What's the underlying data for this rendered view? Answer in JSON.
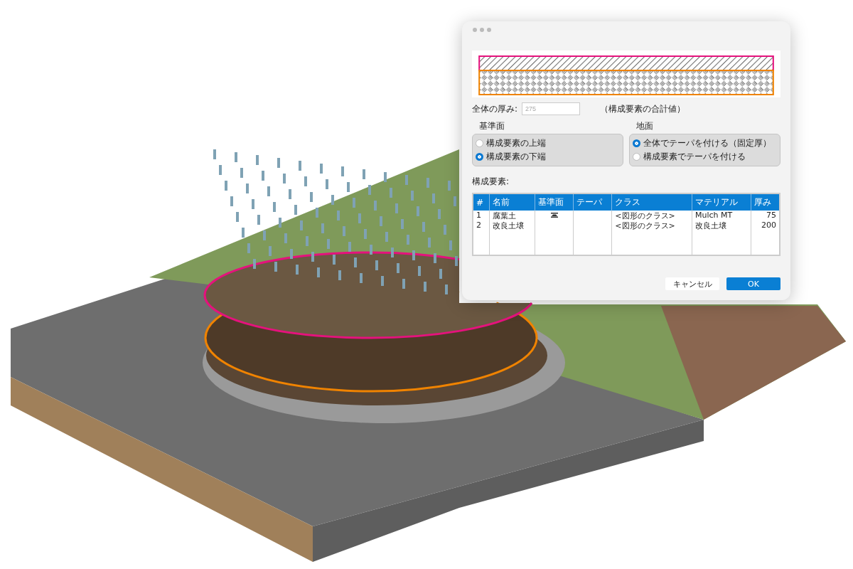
{
  "dialog": {
    "preview": {
      "layers": [
        {
          "kind": "diagonal",
          "color": "#e5127d"
        },
        {
          "kind": "weave",
          "color": "#f08300"
        }
      ]
    },
    "thickness": {
      "label": "全体の厚み:",
      "value": "275",
      "note": "（構成要素の合計値）"
    },
    "groups": [
      {
        "title": "基準面",
        "options": [
          {
            "label": "構成要素の上端",
            "selected": false
          },
          {
            "label": "構成要素の下端",
            "selected": true
          }
        ]
      },
      {
        "title": "地面",
        "options": [
          {
            "label": "全体でテーパを付ける（固定厚）",
            "selected": true
          },
          {
            "label": "構成要素でテーパを付ける",
            "selected": false
          }
        ]
      }
    ],
    "table": {
      "label": "構成要素:",
      "columns": [
        "#",
        "名前",
        "基準面",
        "テーパ",
        "クラス",
        "マテリアル",
        "厚み"
      ],
      "rows": [
        {
          "number": "1",
          "name": "腐葉土",
          "base_marker": true,
          "taper": "",
          "class": "<図形のクラス>",
          "material": "Mulch MT",
          "thickness": "75"
        },
        {
          "number": "2",
          "name": "改良土壌",
          "base_marker": false,
          "taper": "",
          "class": "<図形のクラス>",
          "material": "改良土壌",
          "thickness": "200"
        }
      ]
    },
    "buttons": [
      {
        "label": "キャンセル",
        "kind": "secondary"
      },
      {
        "label": "OK",
        "kind": "primary"
      }
    ]
  }
}
